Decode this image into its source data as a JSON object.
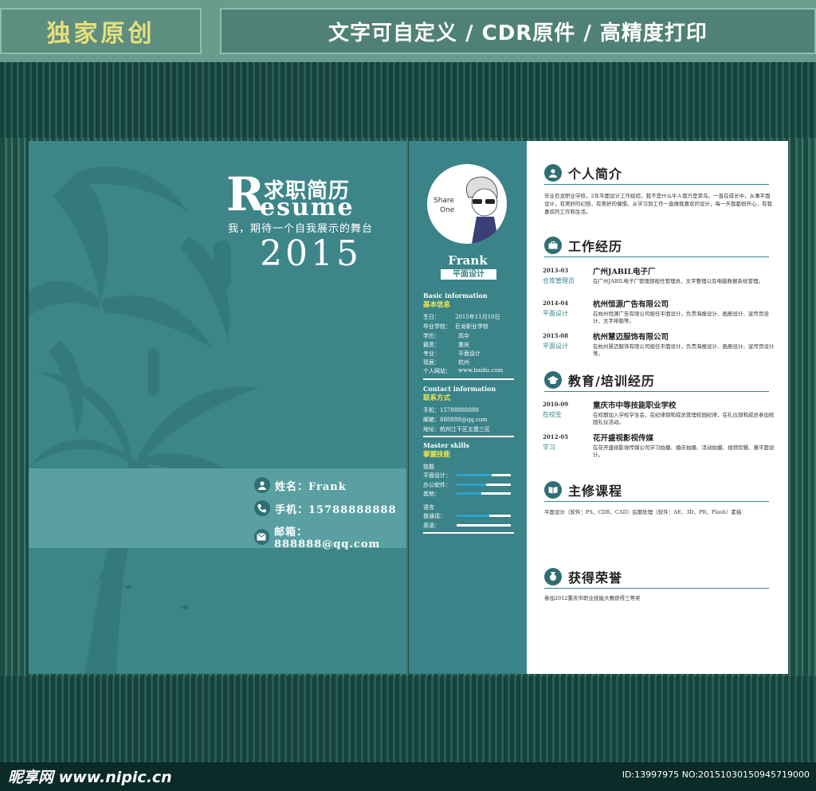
{
  "banner": {
    "left": "独家原创",
    "right": "文字可自定义 / CDR原件 / 高精度打印"
  },
  "cover": {
    "r_letter": "R",
    "title_cn": "求职简历",
    "title_en": "esume",
    "slogan": "我，期待一个自我展示的舞台",
    "year": "2015",
    "contacts": [
      {
        "label": "姓名：Frank",
        "icon": "person-icon"
      },
      {
        "label": "手机：15788888888",
        "icon": "phone-icon"
      },
      {
        "label": "邮箱：888888@qq.com",
        "icon": "mail-icon"
      }
    ]
  },
  "sidebar": {
    "avatar_text": [
      "Share",
      "One"
    ],
    "name": "Frank",
    "job": "平面设计",
    "basic_en": "Basic information",
    "basic_cn": "基本信息",
    "basic": [
      {
        "k": "生日：",
        "v": "2015年11月10日"
      },
      {
        "k": "毕业学校：",
        "v": "巨龙职业学校"
      },
      {
        "k": "学历：",
        "v": "高中"
      },
      {
        "k": "籍贯：",
        "v": "重庆"
      },
      {
        "k": "专业：",
        "v": "平面设计"
      },
      {
        "k": "现居：",
        "v": "杭州"
      },
      {
        "k": "个人网站：",
        "v": "www.baidu.com"
      }
    ],
    "contact_en": "Contact information",
    "contact_cn": "联系方式",
    "contact": [
      "手机：15788888888",
      "邮箱：888888@qq.com",
      "地址：杭州江干区五堡三区"
    ],
    "skills_en": "Master skills",
    "skills_cn": "掌握技能",
    "skill_group1": "技能",
    "skills": [
      {
        "name": "平面设计：",
        "level": 0.65
      },
      {
        "name": "办公软件：",
        "level": 0.55
      },
      {
        "name": "其他：",
        "level": 0.45
      }
    ],
    "skill_group2": "语言",
    "langs": [
      {
        "name": "普通话：",
        "level": 0.6
      },
      {
        "name": "英语：",
        "level": 0.0
      }
    ]
  },
  "main": {
    "intro_title": "个人简介",
    "intro_text": "毕业巨龙职业学校，2年平面设计工作经验，我不是什么牛人我只是菜鸟，一直在成长中，从事平面设计，有美好的幻想，有美好的憧憬。从学习到工作一直做我喜欢的设计，每一天我都很开心，有我喜欢的工作和生活。",
    "work_title": "工作经历",
    "work": [
      {
        "date": "2013-03",
        "role": "仓库管理员",
        "company": "广州JABIL电子厂",
        "desc": "在广州JABIL电子厂管理部担任管理员，文字整理以及电脑数据系统管理。"
      },
      {
        "date": "2014-04",
        "role": "平面设计",
        "company": "杭州恒源广告有限公司",
        "desc": "在杭州恒源广告有限公司担任平面设计，负责海报设计、画册设计、宣传页设计、文字排版等。"
      },
      {
        "date": "2015-08",
        "role": "平面设计",
        "company": "杭州慧迈服饰有限公司",
        "desc": "在杭州慧迈服饰有限公司担任平面设计，负责海报设计、画册设计、宣传页设计等。"
      }
    ],
    "edu_title": "教育/培训经历",
    "edu": [
      {
        "date": "2010-09",
        "role": "在校生",
        "company": "重庆市中等技能职业学校",
        "desc": "在校期加入学校学生会，在纪律部和成员管理校园纪律，在礼仪部和成员参加校园礼仪活动。"
      },
      {
        "date": "2012-05",
        "role": "学习",
        "company": "花开盛视影视传媒",
        "desc": "在花开盛视影视传媒公司学习拍摄、婚庆拍摄、活动拍摄、视频剪辑、兼平面设计。"
      }
    ],
    "course_title": "主修课程",
    "course_text": "平面设计（软件：PS、CDR、CAD）后期处理（软件：AE、3D、PR、Flash）素描",
    "honor_title": "获得荣誉",
    "honor_text": "参加2012重庆市职业技能大赛获得三等奖"
  },
  "footer": {
    "logo": "昵享网 www.nipic.cn",
    "id": "ID:13997975 NO:20151030150945719000"
  }
}
